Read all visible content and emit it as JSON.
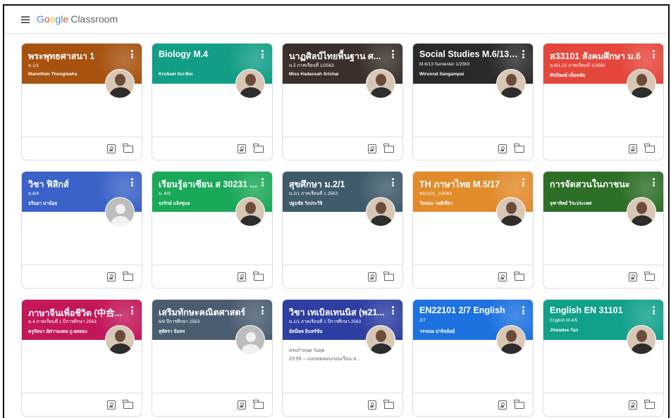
{
  "header": {
    "logo_google": [
      "G",
      "o",
      "o",
      "g",
      "l",
      "e"
    ],
    "logo_product": "Classroom"
  },
  "colors": {
    "orange_brown": "#a8520f",
    "teal": "#129e86",
    "dark": "#3a2f2a",
    "black": "#2a2a2a",
    "red": "#e5463b",
    "blue": "#3a62c8",
    "green": "#1aa859",
    "slate": "#3f5a6a",
    "orange": "#e28b2b",
    "dark_green": "#2d6f27",
    "magenta": "#c3175a",
    "gray_blue": "#4a5d70",
    "indigo": "#2f3ea3",
    "bright_blue": "#1e72e0",
    "sea_green": "#11a08a"
  },
  "cards": [
    {
      "title": "พระพุทธศาสนา 1",
      "section": "ม.1/1",
      "teacher": "Manothim Thongmaha",
      "avatar": "photo",
      "icon": "teacher-photo"
    },
    {
      "title": "Biology M.4",
      "section": "",
      "teacher": "KruSaei Sci-Bio",
      "avatar": "photo",
      "icon": "teacher-photo"
    },
    {
      "title": "นาฏศิลป์ไทยพื้นฐาน ศ...",
      "section": "ม.5 ภาคเรียนที่ 1/2563",
      "teacher": "Miss Hadassah Srichai",
      "avatar": "photo",
      "icon": "teacher-photo"
    },
    {
      "title": "Social Studies M.6/13 ...",
      "section": "M.6/13 Semester 1/2563",
      "teacher": "Wirunrat Sangampai",
      "avatar": "photo",
      "icon": "teacher-photo"
    },
    {
      "title": "ส33101 สังคมศึกษา ม.6",
      "section": "ม.6/1-12 ภาคเรียนที่ 1/2563",
      "teacher": "พัชนิพงษ์ เข็มคลัด",
      "avatar": "photo",
      "icon": "teacher-photo"
    },
    {
      "title": "วิชา ฟิสิกส์",
      "section": "ม.6/4",
      "teacher": "อรินยา มาน้อย",
      "avatar": "default",
      "icon": "default-avatar"
    },
    {
      "title": "เรียนรู้อาเซียน ส 30231 ...",
      "section": "ม. 6/9",
      "teacher": "จงรักษ์ แจ้งชุมล",
      "avatar": "photo",
      "icon": "teacher-photo"
    },
    {
      "title": "สุขศึกษา ม.2/1",
      "section": "ม.2/1 ภาคเรียนที่ 1 2563",
      "teacher": "ปฐมชัย วังประวิจิ",
      "avatar": "photo",
      "icon": "teacher-photo"
    },
    {
      "title": "TH ภาษาไทย M.5/17",
      "section": "ท32101_1/2563",
      "teacher": "วันชนะ วงศ์เขียว",
      "avatar": "photo",
      "icon": "teacher-photo"
    },
    {
      "title": "การจัดสวนในภาชนะ",
      "section": "",
      "teacher": "จุฑาทิพย์ วิระประเทศ",
      "avatar": "photo",
      "icon": "teacher-photo"
    },
    {
      "title": "ภาษาจีนเพื่อชีวิต (中合...",
      "section": "ม.4 ภาคเรียนที่ 1 ปีการศึกษา 2563",
      "teacher": "ครูรัตนา อัศวามงคล ภู ผลทอง",
      "avatar": "photo",
      "icon": "teacher-photo"
    },
    {
      "title": "เสริมทักษะคณิตศาสตร์",
      "section": "6/9 ปีการศึกษา 2563",
      "teacher": "สุทัศรา จันทร",
      "avatar": "default",
      "icon": "default-avatar"
    },
    {
      "title": "วิชา เทเบิลเทนนิส (พ21...",
      "section": "ม.1/1 ภาคเรียนที่ 1 ปีการศึกษา 2563",
      "teacher": "อัคนีพล อินทร์ข้ม",
      "avatar": "photo",
      "icon": "teacher-photo",
      "assignment": {
        "due": "ครบกำหนด วันพุธ",
        "item": "23:59 – แบบทดสอบก่อนเรียน ห..."
      }
    },
    {
      "title": "EN22101 2/7 English",
      "section": "2/7",
      "teacher": "วรรณพ ปาจิจฉัยย์",
      "avatar": "photo",
      "icon": "teacher-photo"
    },
    {
      "title": "English EN 31101",
      "section": "English M.4/5",
      "teacher": "Jitwadee Tan",
      "avatar": "photo",
      "icon": "teacher-photo"
    }
  ],
  "footer_icons": [
    "assignment-icon",
    "folder-icon"
  ]
}
